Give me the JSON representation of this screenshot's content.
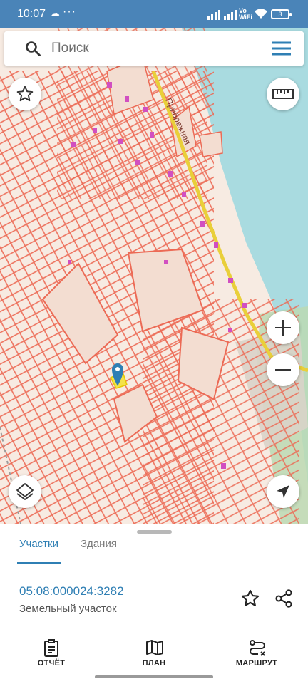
{
  "status_bar": {
    "time": "10:07",
    "extra": "···",
    "volte_line1": "Vo",
    "volte_line2": "WiFi",
    "battery": "3"
  },
  "search": {
    "placeholder": "Поиск"
  },
  "map": {
    "street_label": "Прибрежная"
  },
  "tabs": {
    "active": "Участки",
    "inactive": "Здания"
  },
  "parcel": {
    "cadastral_number": "05:08:000024:3282",
    "type": "Земельный участок"
  },
  "bottom_nav": {
    "report": "ОТЧЁТ",
    "plan": "ПЛАН",
    "route": "МАРШРУТ"
  },
  "colors": {
    "accent": "#2f7fb4",
    "status_bar": "#4a84b8",
    "parcel_outline": "#ec6a55",
    "map_background": "#f7ebe2",
    "water": "#a9dbe0",
    "road": "#e9cf3a"
  }
}
